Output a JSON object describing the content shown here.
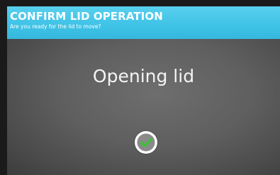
{
  "header": {
    "title": "CONFIRM LID OPERATION",
    "subtitle": "Are you ready for the lid to move?"
  },
  "main": {
    "status_text": "Opening lid",
    "confirm_button": {
      "icon": "check-icon",
      "inner_color": "#8a8a8a",
      "check_color": "#3dbf3a"
    }
  },
  "colors": {
    "header_bg": "#3ec2e6",
    "panel_bg": "#5f5f5f",
    "text": "#ffffff"
  }
}
